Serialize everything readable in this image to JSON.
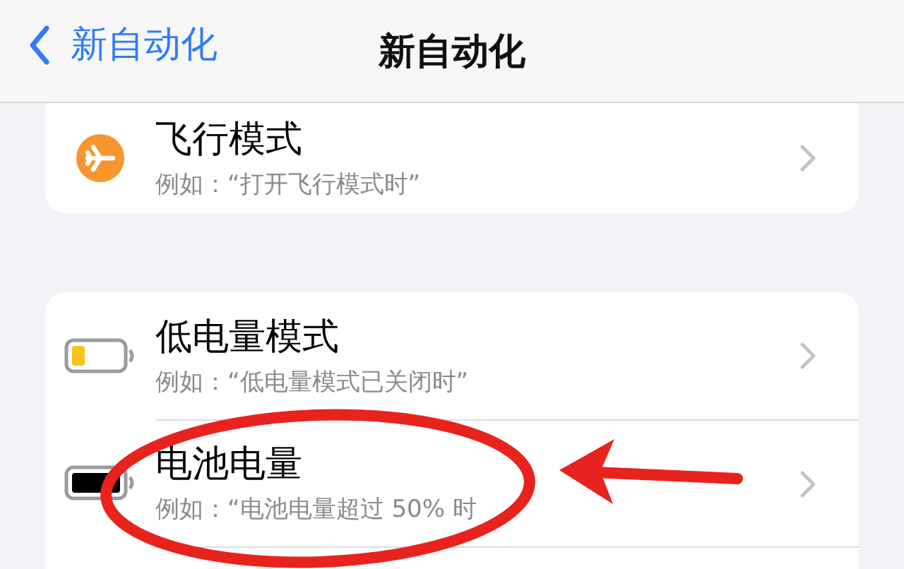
{
  "nav": {
    "back": "新自动化",
    "title": "新自动化"
  },
  "sections": [
    {
      "rows": [
        {
          "kind": "airplane",
          "title": "飞行模式",
          "subtitle": "例如：“打开飞行模式时”"
        }
      ]
    },
    {
      "rows": [
        {
          "kind": "battery-low",
          "title": "低电量模式",
          "subtitle": "例如：“低电量模式已关闭时”"
        },
        {
          "kind": "battery-full",
          "title": "电池电量",
          "subtitle": "例如：“电池电量超过 50% 时"
        }
      ]
    }
  ]
}
